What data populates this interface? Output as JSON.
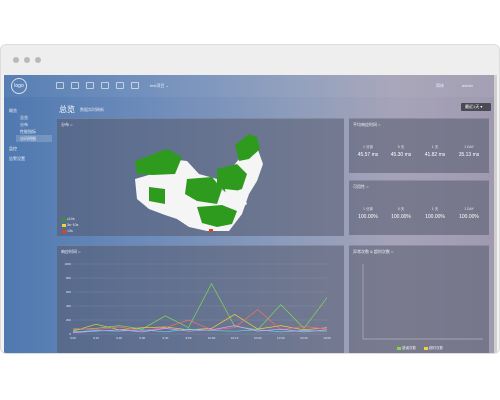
{
  "topbar": {
    "logo_text": "logo",
    "project_selector": "test项目 ⌄",
    "lang": "简体",
    "user": "admin"
  },
  "sidebar": {
    "items": [
      {
        "label": "概览",
        "top": 30
      },
      {
        "label": "监控",
        "top": 70
      },
      {
        "label": "告警设置",
        "top": 80
      }
    ],
    "subitems": [
      {
        "label": "总览",
        "top": 39
      },
      {
        "label": "分布",
        "top": 46
      },
      {
        "label": "性能指标",
        "top": 53
      },
      {
        "label": "访问明细",
        "top": 60
      }
    ]
  },
  "page": {
    "title": "总览",
    "subtitle": "数据实时刷新",
    "button": "最近1天 ▾"
  },
  "panels": {
    "map": {
      "title": "分布 ○",
      "legend": [
        "≥10s",
        "3s~10s",
        "<3s"
      ]
    },
    "response_time": {
      "title": "平均响应时间 ○",
      "columns": [
        {
          "label": "1 分钟",
          "value": "45.57 ms"
        },
        {
          "label": "5 天",
          "value": "45.30 ms"
        },
        {
          "label": "1 天",
          "value": "41.82 ms"
        },
        {
          "label": "1 DAY",
          "value": "35.13 ms"
        }
      ]
    },
    "availability": {
      "title": "可用性 ○",
      "columns": [
        {
          "label": "1 分钟",
          "value": "100.00%"
        },
        {
          "label": "5 天",
          "value": "100.00%"
        },
        {
          "label": "1 天",
          "value": "100.00%"
        },
        {
          "label": "1 DAY",
          "value": "100.00%"
        }
      ]
    },
    "latency_chart": {
      "title": "响应时间 ○"
    },
    "bar_chart": {
      "title": "异常次数 & 超时次数 ○",
      "legend": [
        "错误次数",
        "超时次数"
      ]
    }
  },
  "chart_data": [
    {
      "type": "line",
      "title": "响应时间",
      "ylim": [
        0,
        1000
      ],
      "yticks": [
        "1000",
        "800",
        "600",
        "400",
        "200",
        "0"
      ],
      "x": [
        "9:00",
        "9:10",
        "9:20",
        "9:30",
        "9:40",
        "9:50",
        "10:00",
        "10:10",
        "10:20",
        "10:30",
        "10:40",
        "10:50"
      ],
      "series": [
        {
          "color": "#7ed957",
          "values": [
            60,
            80,
            120,
            70,
            260,
            90,
            720,
            110,
            60,
            420,
            80,
            520
          ]
        },
        {
          "color": "#f4d13e",
          "values": [
            40,
            140,
            60,
            90,
            100,
            60,
            80,
            280,
            70,
            120,
            60,
            90
          ]
        },
        {
          "color": "#ff6b6b",
          "values": [
            80,
            60,
            100,
            50,
            90,
            200,
            60,
            90,
            350,
            60,
            110,
            70
          ]
        },
        {
          "color": "#5ad1f0",
          "values": [
            30,
            50,
            40,
            60,
            30,
            70,
            50,
            40,
            60,
            30,
            50,
            40
          ]
        },
        {
          "color": "#d8a0ff",
          "values": [
            20,
            40,
            60,
            30,
            80,
            40,
            60,
            120,
            40,
            70,
            30,
            60
          ]
        }
      ]
    },
    {
      "type": "bar",
      "title": "异常次数 & 超时次数",
      "series": [
        {
          "name": "错误次数",
          "color": "#7ed957",
          "values": []
        },
        {
          "name": "超时次数",
          "color": "#f4d13e",
          "values": []
        }
      ]
    }
  ]
}
